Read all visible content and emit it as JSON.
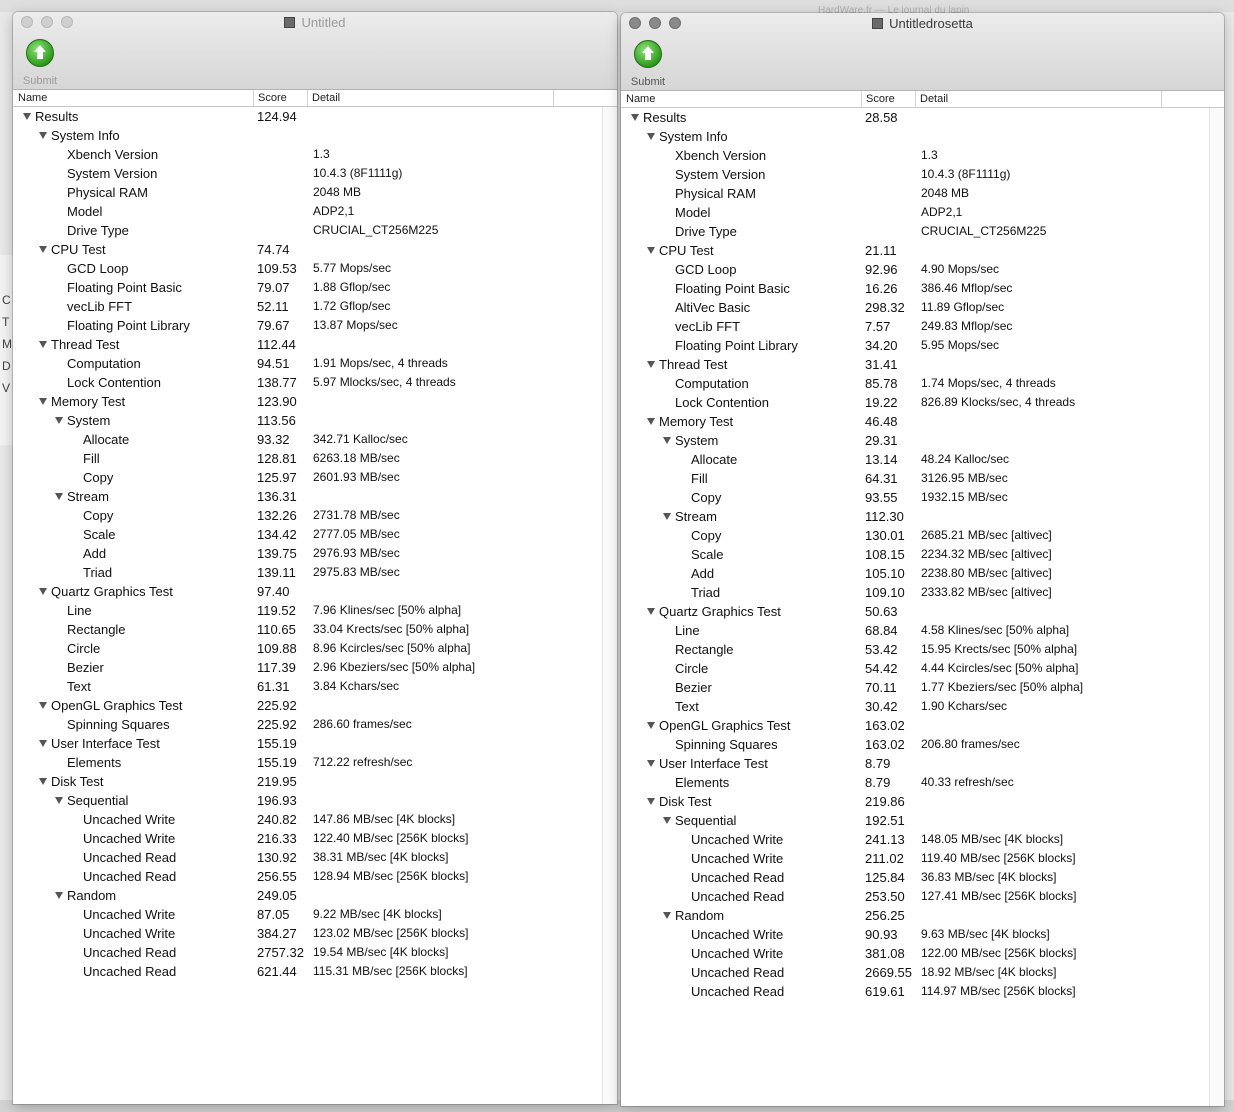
{
  "background": {
    "top_text": "HardWare.fr — Le journal du lapin",
    "left_letters": [
      "C",
      "T",
      "M",
      "D",
      "V"
    ]
  },
  "headers": {
    "name": "Name",
    "score": "Score",
    "detail": "Detail"
  },
  "windows": [
    {
      "title": "Untitled",
      "submit_label": "Submit",
      "rows": [
        {
          "level": 0,
          "toggle": true,
          "name": "Results",
          "score": "124.94",
          "detail": ""
        },
        {
          "level": 1,
          "toggle": true,
          "name": "System Info",
          "score": "",
          "detail": ""
        },
        {
          "level": 2,
          "toggle": false,
          "name": "Xbench Version",
          "score": "",
          "detail": "1.3"
        },
        {
          "level": 2,
          "toggle": false,
          "name": "System Version",
          "score": "",
          "detail": "10.4.3 (8F1111g)"
        },
        {
          "level": 2,
          "toggle": false,
          "name": "Physical RAM",
          "score": "",
          "detail": "2048 MB"
        },
        {
          "level": 2,
          "toggle": false,
          "name": "Model",
          "score": "",
          "detail": "ADP2,1"
        },
        {
          "level": 2,
          "toggle": false,
          "name": "Drive Type",
          "score": "",
          "detail": "CRUCIAL_CT256M225"
        },
        {
          "level": 1,
          "toggle": true,
          "name": "CPU Test",
          "score": "74.74",
          "detail": ""
        },
        {
          "level": 2,
          "toggle": false,
          "name": "GCD Loop",
          "score": "109.53",
          "detail": "5.77 Mops/sec"
        },
        {
          "level": 2,
          "toggle": false,
          "name": "Floating Point Basic",
          "score": "79.07",
          "detail": "1.88 Gflop/sec"
        },
        {
          "level": 2,
          "toggle": false,
          "name": "vecLib FFT",
          "score": "52.11",
          "detail": "1.72 Gflop/sec"
        },
        {
          "level": 2,
          "toggle": false,
          "name": "Floating Point Library",
          "score": "79.67",
          "detail": "13.87 Mops/sec"
        },
        {
          "level": 1,
          "toggle": true,
          "name": "Thread Test",
          "score": "112.44",
          "detail": ""
        },
        {
          "level": 2,
          "toggle": false,
          "name": "Computation",
          "score": "94.51",
          "detail": "1.91 Mops/sec, 4 threads"
        },
        {
          "level": 2,
          "toggle": false,
          "name": "Lock Contention",
          "score": "138.77",
          "detail": "5.97 Mlocks/sec, 4 threads"
        },
        {
          "level": 1,
          "toggle": true,
          "name": "Memory Test",
          "score": "123.90",
          "detail": ""
        },
        {
          "level": 2,
          "toggle": true,
          "name": "System",
          "score": "113.56",
          "detail": ""
        },
        {
          "level": 3,
          "toggle": false,
          "name": "Allocate",
          "score": "93.32",
          "detail": "342.71 Kalloc/sec"
        },
        {
          "level": 3,
          "toggle": false,
          "name": "Fill",
          "score": "128.81",
          "detail": "6263.18 MB/sec"
        },
        {
          "level": 3,
          "toggle": false,
          "name": "Copy",
          "score": "125.97",
          "detail": "2601.93 MB/sec"
        },
        {
          "level": 2,
          "toggle": true,
          "name": "Stream",
          "score": "136.31",
          "detail": ""
        },
        {
          "level": 3,
          "toggle": false,
          "name": "Copy",
          "score": "132.26",
          "detail": "2731.78 MB/sec"
        },
        {
          "level": 3,
          "toggle": false,
          "name": "Scale",
          "score": "134.42",
          "detail": "2777.05 MB/sec"
        },
        {
          "level": 3,
          "toggle": false,
          "name": "Add",
          "score": "139.75",
          "detail": "2976.93 MB/sec"
        },
        {
          "level": 3,
          "toggle": false,
          "name": "Triad",
          "score": "139.11",
          "detail": "2975.83 MB/sec"
        },
        {
          "level": 1,
          "toggle": true,
          "name": "Quartz Graphics Test",
          "score": "97.40",
          "detail": ""
        },
        {
          "level": 2,
          "toggle": false,
          "name": "Line",
          "score": "119.52",
          "detail": "7.96 Klines/sec [50% alpha]"
        },
        {
          "level": 2,
          "toggle": false,
          "name": "Rectangle",
          "score": "110.65",
          "detail": "33.04 Krects/sec [50% alpha]"
        },
        {
          "level": 2,
          "toggle": false,
          "name": "Circle",
          "score": "109.88",
          "detail": "8.96 Kcircles/sec [50% alpha]"
        },
        {
          "level": 2,
          "toggle": false,
          "name": "Bezier",
          "score": "117.39",
          "detail": "2.96 Kbeziers/sec [50% alpha]"
        },
        {
          "level": 2,
          "toggle": false,
          "name": "Text",
          "score": "61.31",
          "detail": "3.84 Kchars/sec"
        },
        {
          "level": 1,
          "toggle": true,
          "name": "OpenGL Graphics Test",
          "score": "225.92",
          "detail": ""
        },
        {
          "level": 2,
          "toggle": false,
          "name": "Spinning Squares",
          "score": "225.92",
          "detail": "286.60 frames/sec"
        },
        {
          "level": 1,
          "toggle": true,
          "name": "User Interface Test",
          "score": "155.19",
          "detail": ""
        },
        {
          "level": 2,
          "toggle": false,
          "name": "Elements",
          "score": "155.19",
          "detail": "712.22 refresh/sec"
        },
        {
          "level": 1,
          "toggle": true,
          "name": "Disk Test",
          "score": "219.95",
          "detail": ""
        },
        {
          "level": 2,
          "toggle": true,
          "name": "Sequential",
          "score": "196.93",
          "detail": ""
        },
        {
          "level": 3,
          "toggle": false,
          "name": "Uncached Write",
          "score": "240.82",
          "detail": "147.86 MB/sec [4K blocks]"
        },
        {
          "level": 3,
          "toggle": false,
          "name": "Uncached Write",
          "score": "216.33",
          "detail": "122.40 MB/sec [256K blocks]"
        },
        {
          "level": 3,
          "toggle": false,
          "name": "Uncached Read",
          "score": "130.92",
          "detail": "38.31 MB/sec [4K blocks]"
        },
        {
          "level": 3,
          "toggle": false,
          "name": "Uncached Read",
          "score": "256.55",
          "detail": "128.94 MB/sec [256K blocks]"
        },
        {
          "level": 2,
          "toggle": true,
          "name": "Random",
          "score": "249.05",
          "detail": ""
        },
        {
          "level": 3,
          "toggle": false,
          "name": "Uncached Write",
          "score": "87.05",
          "detail": "9.22 MB/sec [4K blocks]"
        },
        {
          "level": 3,
          "toggle": false,
          "name": "Uncached Write",
          "score": "384.27",
          "detail": "123.02 MB/sec [256K blocks]"
        },
        {
          "level": 3,
          "toggle": false,
          "name": "Uncached Read",
          "score": "2757.32",
          "detail": "19.54 MB/sec [4K blocks]"
        },
        {
          "level": 3,
          "toggle": false,
          "name": "Uncached Read",
          "score": "621.44",
          "detail": "115.31 MB/sec [256K blocks]"
        }
      ]
    },
    {
      "title": "Untitledrosetta",
      "submit_label": "Submit",
      "rows": [
        {
          "level": 0,
          "toggle": true,
          "name": "Results",
          "score": "28.58",
          "detail": ""
        },
        {
          "level": 1,
          "toggle": true,
          "name": "System Info",
          "score": "",
          "detail": ""
        },
        {
          "level": 2,
          "toggle": false,
          "name": "Xbench Version",
          "score": "",
          "detail": "1.3"
        },
        {
          "level": 2,
          "toggle": false,
          "name": "System Version",
          "score": "",
          "detail": "10.4.3 (8F1111g)"
        },
        {
          "level": 2,
          "toggle": false,
          "name": "Physical RAM",
          "score": "",
          "detail": "2048 MB"
        },
        {
          "level": 2,
          "toggle": false,
          "name": "Model",
          "score": "",
          "detail": "ADP2,1"
        },
        {
          "level": 2,
          "toggle": false,
          "name": "Drive Type",
          "score": "",
          "detail": "CRUCIAL_CT256M225"
        },
        {
          "level": 1,
          "toggle": true,
          "name": "CPU Test",
          "score": "21.11",
          "detail": ""
        },
        {
          "level": 2,
          "toggle": false,
          "name": "GCD Loop",
          "score": "92.96",
          "detail": "4.90 Mops/sec"
        },
        {
          "level": 2,
          "toggle": false,
          "name": "Floating Point Basic",
          "score": "16.26",
          "detail": "386.46 Mflop/sec"
        },
        {
          "level": 2,
          "toggle": false,
          "name": "AltiVec Basic",
          "score": "298.32",
          "detail": "11.89 Gflop/sec"
        },
        {
          "level": 2,
          "toggle": false,
          "name": "vecLib FFT",
          "score": "7.57",
          "detail": "249.83 Mflop/sec"
        },
        {
          "level": 2,
          "toggle": false,
          "name": "Floating Point Library",
          "score": "34.20",
          "detail": "5.95 Mops/sec"
        },
        {
          "level": 1,
          "toggle": true,
          "name": "Thread Test",
          "score": "31.41",
          "detail": ""
        },
        {
          "level": 2,
          "toggle": false,
          "name": "Computation",
          "score": "85.78",
          "detail": "1.74 Mops/sec, 4 threads"
        },
        {
          "level": 2,
          "toggle": false,
          "name": "Lock Contention",
          "score": "19.22",
          "detail": "826.89 Klocks/sec, 4 threads"
        },
        {
          "level": 1,
          "toggle": true,
          "name": "Memory Test",
          "score": "46.48",
          "detail": ""
        },
        {
          "level": 2,
          "toggle": true,
          "name": "System",
          "score": "29.31",
          "detail": ""
        },
        {
          "level": 3,
          "toggle": false,
          "name": "Allocate",
          "score": "13.14",
          "detail": "48.24 Kalloc/sec"
        },
        {
          "level": 3,
          "toggle": false,
          "name": "Fill",
          "score": "64.31",
          "detail": "3126.95 MB/sec"
        },
        {
          "level": 3,
          "toggle": false,
          "name": "Copy",
          "score": "93.55",
          "detail": "1932.15 MB/sec"
        },
        {
          "level": 2,
          "toggle": true,
          "name": "Stream",
          "score": "112.30",
          "detail": ""
        },
        {
          "level": 3,
          "toggle": false,
          "name": "Copy",
          "score": "130.01",
          "detail": "2685.21 MB/sec [altivec]"
        },
        {
          "level": 3,
          "toggle": false,
          "name": "Scale",
          "score": "108.15",
          "detail": "2234.32 MB/sec [altivec]"
        },
        {
          "level": 3,
          "toggle": false,
          "name": "Add",
          "score": "105.10",
          "detail": "2238.80 MB/sec [altivec]"
        },
        {
          "level": 3,
          "toggle": false,
          "name": "Triad",
          "score": "109.10",
          "detail": "2333.82 MB/sec [altivec]"
        },
        {
          "level": 1,
          "toggle": true,
          "name": "Quartz Graphics Test",
          "score": "50.63",
          "detail": ""
        },
        {
          "level": 2,
          "toggle": false,
          "name": "Line",
          "score": "68.84",
          "detail": "4.58 Klines/sec [50% alpha]"
        },
        {
          "level": 2,
          "toggle": false,
          "name": "Rectangle",
          "score": "53.42",
          "detail": "15.95 Krects/sec [50% alpha]"
        },
        {
          "level": 2,
          "toggle": false,
          "name": "Circle",
          "score": "54.42",
          "detail": "4.44 Kcircles/sec [50% alpha]"
        },
        {
          "level": 2,
          "toggle": false,
          "name": "Bezier",
          "score": "70.11",
          "detail": "1.77 Kbeziers/sec [50% alpha]"
        },
        {
          "level": 2,
          "toggle": false,
          "name": "Text",
          "score": "30.42",
          "detail": "1.90 Kchars/sec"
        },
        {
          "level": 1,
          "toggle": true,
          "name": "OpenGL Graphics Test",
          "score": "163.02",
          "detail": ""
        },
        {
          "level": 2,
          "toggle": false,
          "name": "Spinning Squares",
          "score": "163.02",
          "detail": "206.80 frames/sec"
        },
        {
          "level": 1,
          "toggle": true,
          "name": "User Interface Test",
          "score": "8.79",
          "detail": ""
        },
        {
          "level": 2,
          "toggle": false,
          "name": "Elements",
          "score": "8.79",
          "detail": "40.33 refresh/sec"
        },
        {
          "level": 1,
          "toggle": true,
          "name": "Disk Test",
          "score": "219.86",
          "detail": ""
        },
        {
          "level": 2,
          "toggle": true,
          "name": "Sequential",
          "score": "192.51",
          "detail": ""
        },
        {
          "level": 3,
          "toggle": false,
          "name": "Uncached Write",
          "score": "241.13",
          "detail": "148.05 MB/sec [4K blocks]"
        },
        {
          "level": 3,
          "toggle": false,
          "name": "Uncached Write",
          "score": "211.02",
          "detail": "119.40 MB/sec [256K blocks]"
        },
        {
          "level": 3,
          "toggle": false,
          "name": "Uncached Read",
          "score": "125.84",
          "detail": "36.83 MB/sec [4K blocks]"
        },
        {
          "level": 3,
          "toggle": false,
          "name": "Uncached Read",
          "score": "253.50",
          "detail": "127.41 MB/sec [256K blocks]"
        },
        {
          "level": 2,
          "toggle": true,
          "name": "Random",
          "score": "256.25",
          "detail": ""
        },
        {
          "level": 3,
          "toggle": false,
          "name": "Uncached Write",
          "score": "90.93",
          "detail": "9.63 MB/sec [4K blocks]"
        },
        {
          "level": 3,
          "toggle": false,
          "name": "Uncached Write",
          "score": "381.08",
          "detail": "122.00 MB/sec [256K blocks]"
        },
        {
          "level": 3,
          "toggle": false,
          "name": "Uncached Read",
          "score": "2669.55",
          "detail": "18.92 MB/sec [4K blocks]"
        },
        {
          "level": 3,
          "toggle": false,
          "name": "Uncached Read",
          "score": "619.61",
          "detail": "114.97 MB/sec [256K blocks]"
        }
      ]
    }
  ]
}
